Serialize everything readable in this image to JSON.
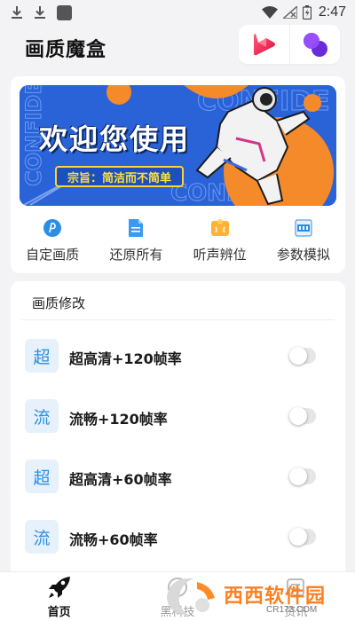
{
  "status_bar": {
    "time": "2:47"
  },
  "header": {
    "title": "画质魔盒"
  },
  "banner": {
    "title": "欢迎您使用",
    "slogan": "宗旨：简洁而不简单"
  },
  "quick_actions": [
    {
      "label": "自定画质",
      "icon": "custom-quality-icon"
    },
    {
      "label": "还原所有",
      "icon": "restore-icon"
    },
    {
      "label": "听声辨位",
      "icon": "sound-locate-icon"
    },
    {
      "label": "参数模拟",
      "icon": "param-sim-icon"
    }
  ],
  "quality_section": {
    "title": "画质修改",
    "options": [
      {
        "badge": "超",
        "label": "超高清+120帧率",
        "enabled": false
      },
      {
        "badge": "流",
        "label": "流畅+120帧率",
        "enabled": false
      },
      {
        "badge": "超",
        "label": "超高清+60帧率",
        "enabled": false
      },
      {
        "badge": "流",
        "label": "流畅+60帧率",
        "enabled": false
      }
    ]
  },
  "bottom_nav": {
    "items": [
      {
        "label": "首页",
        "active": true
      },
      {
        "label": "黑科技",
        "active": false
      },
      {
        "label": "资讯",
        "active": false
      }
    ]
  },
  "watermark": {
    "text": "西西软件园",
    "url": "CR173.COM"
  },
  "colors": {
    "accent": "#2b8ee6",
    "badge_bg": "#e6f1fb",
    "banner_bg": "#2a62d8"
  }
}
